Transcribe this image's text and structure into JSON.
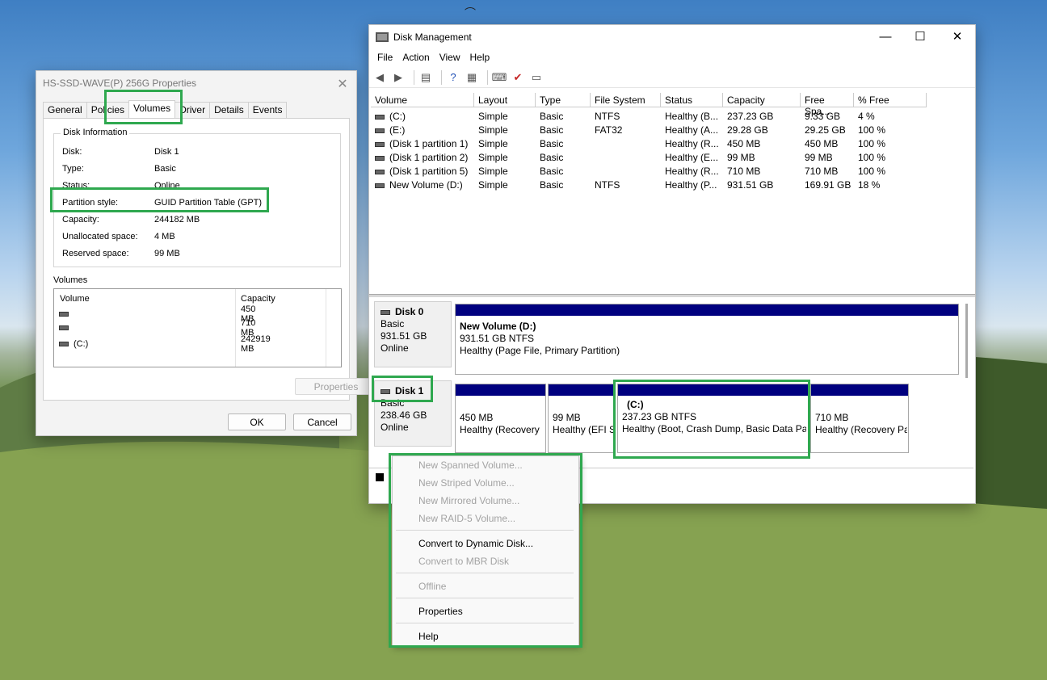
{
  "properties_dialog": {
    "title": "HS-SSD-WAVE(P) 256G Properties",
    "tabs": [
      "General",
      "Policies",
      "Volumes",
      "Driver",
      "Details",
      "Events"
    ],
    "active_tab": "Volumes",
    "disk_info_caption": "Disk Information",
    "info": [
      {
        "label": "Disk:",
        "value": "Disk 1"
      },
      {
        "label": "Type:",
        "value": "Basic"
      },
      {
        "label": "Status:",
        "value": "Online"
      },
      {
        "label": "Partition style:",
        "value": "GUID Partition Table (GPT)"
      },
      {
        "label": "Capacity:",
        "value": "244182 MB"
      },
      {
        "label": "Unallocated space:",
        "value": "4 MB"
      },
      {
        "label": "Reserved space:",
        "value": "99 MB"
      }
    ],
    "volumes_caption": "Volumes",
    "volumes_columns": [
      "Volume",
      "Capacity"
    ],
    "volumes": [
      {
        "volume": "",
        "capacity": "450 MB"
      },
      {
        "volume": "",
        "capacity": "710 MB"
      },
      {
        "volume": "(C:)",
        "capacity": "242919 MB"
      }
    ],
    "properties_button": "Properties",
    "ok_button": "OK",
    "cancel_button": "Cancel"
  },
  "disk_management": {
    "title": "Disk Management",
    "menu": [
      "File",
      "Action",
      "View",
      "Help"
    ],
    "columns": [
      "Volume",
      "Layout",
      "Type",
      "File System",
      "Status",
      "Capacity",
      "Free Spa...",
      "% Free"
    ],
    "rows": [
      [
        "(C:)",
        "Simple",
        "Basic",
        "NTFS",
        "Healthy (B...",
        "237.23 GB",
        "9.33 GB",
        "4 %"
      ],
      [
        "(E:)",
        "Simple",
        "Basic",
        "FAT32",
        "Healthy (A...",
        "29.28 GB",
        "29.25 GB",
        "100 %"
      ],
      [
        "(Disk 1 partition 1)",
        "Simple",
        "Basic",
        "",
        "Healthy (R...",
        "450 MB",
        "450 MB",
        "100 %"
      ],
      [
        "(Disk 1 partition 2)",
        "Simple",
        "Basic",
        "",
        "Healthy (E...",
        "99 MB",
        "99 MB",
        "100 %"
      ],
      [
        "(Disk 1 partition 5)",
        "Simple",
        "Basic",
        "",
        "Healthy (R...",
        "710 MB",
        "710 MB",
        "100 %"
      ],
      [
        "New Volume (D:)",
        "Simple",
        "Basic",
        "NTFS",
        "Healthy (P...",
        "931.51 GB",
        "169.91 GB",
        "18 %"
      ]
    ],
    "disks": [
      {
        "name": "Disk 0",
        "type": "Basic",
        "size": "931.51 GB",
        "status": "Online",
        "partitions": [
          {
            "title": "New Volume  (D:)",
            "line2": "931.51 GB NTFS",
            "line3": "Healthy (Page File, Primary Partition)"
          }
        ]
      },
      {
        "name": "Disk 1",
        "type": "Basic",
        "size": "238.46 GB",
        "status": "Online",
        "partitions": [
          {
            "title": "",
            "line2": "450 MB",
            "line3": "Healthy (Recovery"
          },
          {
            "title": "",
            "line2": "99 MB",
            "line3": "Healthy (EFI S"
          },
          {
            "title": "(C:)",
            "line2": "237.23 GB NTFS",
            "line3": "Healthy (Boot, Crash Dump, Basic Data Pa"
          },
          {
            "title": "",
            "line2": "710 MB",
            "line3": "Healthy (Recovery Pa"
          }
        ]
      }
    ]
  },
  "context_menu": {
    "items": [
      {
        "label": "New Spanned Volume...",
        "enabled": false
      },
      {
        "label": "New Striped Volume...",
        "enabled": false
      },
      {
        "label": "New Mirrored Volume...",
        "enabled": false
      },
      {
        "label": "New RAID-5 Volume...",
        "enabled": false
      },
      {
        "label": "Convert to Dynamic Disk...",
        "enabled": true
      },
      {
        "label": "Convert to MBR Disk",
        "enabled": false
      },
      {
        "label": "Offline",
        "enabled": false
      },
      {
        "label": "Properties",
        "enabled": true
      },
      {
        "label": "Help",
        "enabled": true
      }
    ]
  },
  "colors": {
    "highlight": "#2fa84f",
    "partition_bar": "#00007f"
  }
}
